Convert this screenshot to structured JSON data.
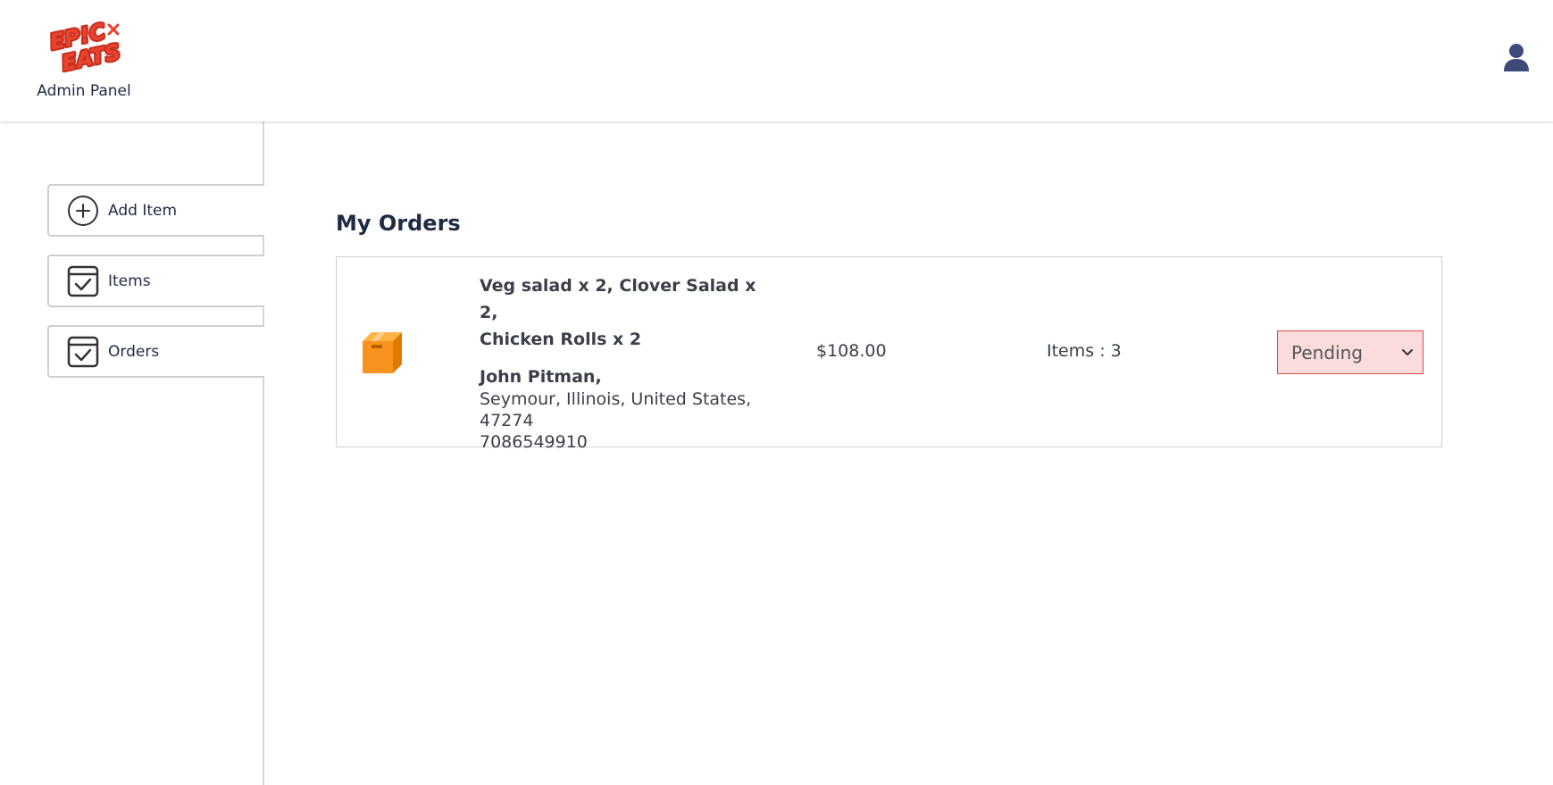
{
  "header": {
    "brand": "EPIC EATS",
    "subtitle": "Admin Panel",
    "icons": {
      "logo": "epic-eats-logo",
      "profile": "user-profile-icon"
    },
    "colors": {
      "logo_red": "#e8432e",
      "profile": "#3d4a7a"
    }
  },
  "sidebar": {
    "items": [
      {
        "label": "Add Item",
        "icon": "add-circle-icon"
      },
      {
        "label": "Items",
        "icon": "checklist-icon"
      },
      {
        "label": "Orders",
        "icon": "checklist-icon"
      }
    ]
  },
  "main": {
    "title": "My Orders",
    "orders": [
      {
        "items_line1": "Veg salad x 2, Clover Salad x 2,",
        "items_line2": "Chicken Rolls x 2",
        "customer": "John Pitman,",
        "address_line1": "Seymour, Illinois, United States,",
        "address_line2": "47274",
        "phone": "7086549910",
        "amount": "$108.00",
        "item_count": "Items : 3",
        "status": "Pending",
        "icon": "parcel-box-icon"
      }
    ]
  },
  "colors": {
    "status_bg": "#fadcdc",
    "status_border": "#e04848",
    "parcel": "#f7931e"
  }
}
